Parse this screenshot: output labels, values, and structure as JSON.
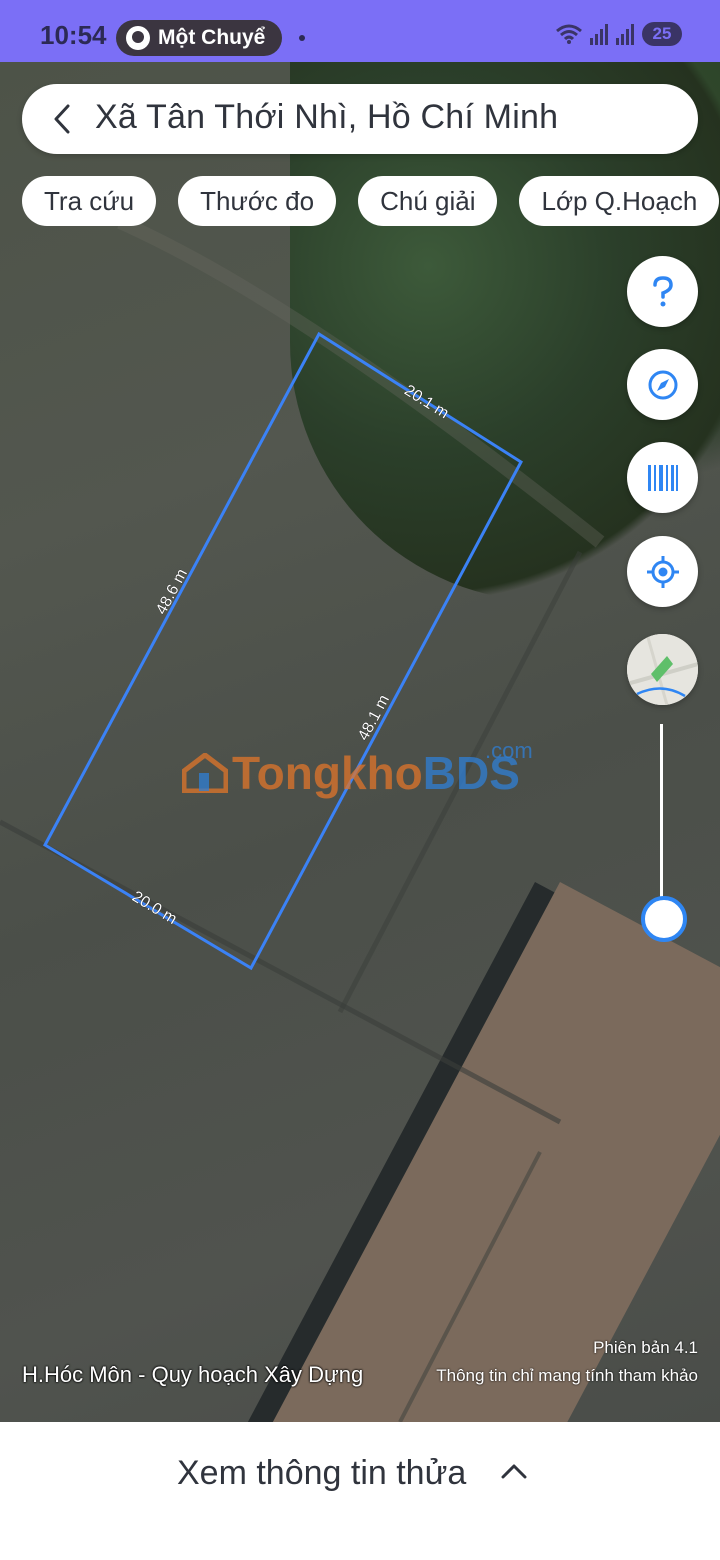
{
  "status_bar": {
    "time": "10:54",
    "notification": "Một Chuyể",
    "battery": "25"
  },
  "search": {
    "title": "Xã Tân Thới Nhì, Hồ Chí Minh"
  },
  "chips": [
    {
      "label": "Tra cứu"
    },
    {
      "label": "Thước đo"
    },
    {
      "label": "Chú giải"
    },
    {
      "label": "Lớp Q.Hoạch"
    }
  ],
  "controls": {
    "help_icon": "question-icon",
    "compass_icon": "compass-icon",
    "barcode_icon": "barcode-icon",
    "locate_icon": "locate-icon",
    "zoom_level": 0.05
  },
  "measurements": {
    "top": "20.1 m",
    "left": "48.6 m",
    "right": "48.1 m",
    "bottom": "20.0 m"
  },
  "watermark": {
    "part1": "Tongkho",
    "part2": "BDS",
    "suffix": ".com"
  },
  "map_footer": {
    "version": "Phiên bản 4.1",
    "source": "H.Hóc Môn - Quy hoạch Xây Dựng",
    "disclaimer": "Thông tin chỉ mang tính tham khảo"
  },
  "bottom_sheet": {
    "label": "Xem thông tin thửa"
  },
  "colors": {
    "status_bar": "#7b6ff6",
    "parcel_outline": "#3b82f6",
    "accent": "#2f86f3"
  }
}
